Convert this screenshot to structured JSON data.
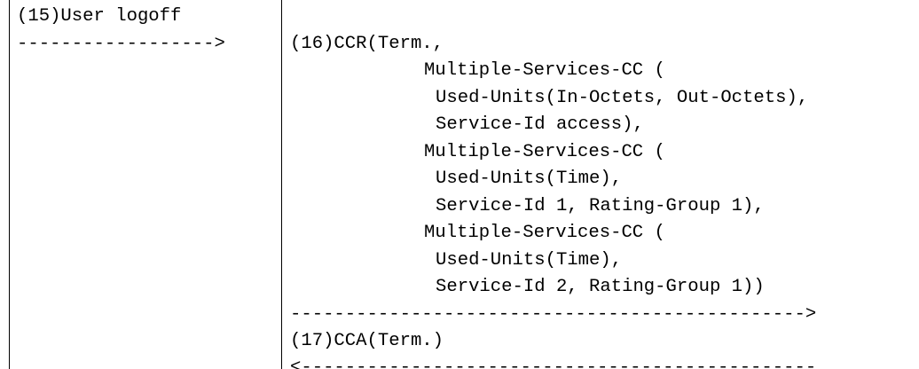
{
  "diagram": {
    "step15": {
      "label": "(15)User logoff",
      "arrow": "------------------>"
    },
    "step16": {
      "lines": [
        "(16)CCR(Term.,",
        "Multiple-Services-CC (",
        "Used-Units(In-Octets, Out-Octets),",
        "Service-Id access),",
        "Multiple-Services-CC (",
        "Used-Units(Time),",
        "Service-Id 1, Rating-Group 1),",
        "Multiple-Services-CC (",
        "Used-Units(Time),",
        "Service-Id 2, Rating-Group 1))"
      ],
      "arrow": "----------------------------------------------->"
    },
    "step17": {
      "label": "(17)CCA(Term.)",
      "arrow": "<-----------------------------------------------"
    }
  }
}
